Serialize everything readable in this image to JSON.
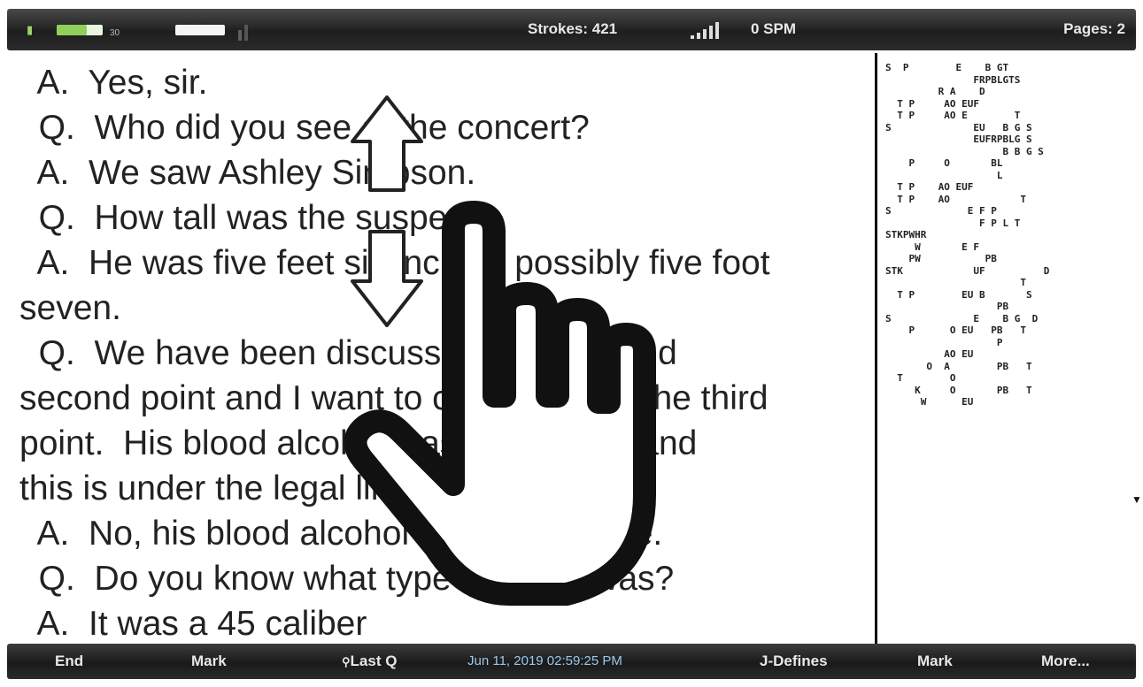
{
  "status": {
    "battery1_label": "30",
    "strokes": "Strokes: 421",
    "spm": "0 SPM",
    "pages": "Pages: 2"
  },
  "transcript": [
    "  A.  Yes, sir.",
    "  Q.  Who did you see at the concert?",
    "  A.  We saw Ashley Simpson.",
    "  Q.  How tall was the suspect?",
    "  A.  He was five feet six inches, possibly five foot",
    "seven.",
    "  Q.  We have been discussing the first and",
    "second point and I want to continue with the third",
    "point.  His blood alcohol was point three and",
    "this is under the legal limit?",
    "  A.  No, his blood alcohol was point three.",
    "  Q.  Do you know what type of gun it was?",
    "  A.  It was a 45 caliber"
  ],
  "steno": [
    "S  P        E    B GT",
    "               FRPBLGTS",
    "         R A    D",
    "  T P     AO EUF",
    "  T P     AO E        T",
    "S              EU   B G S",
    "               EUFRPBLG S",
    "                    B B G S",
    "    P     O       BL",
    "                   L",
    "  T P    AO EUF",
    "  T P    AO            T",
    "S             E F P",
    "                F P L T",
    "STKPWHR",
    "     W       E F",
    "    PW           PB",
    "STK            UF          D",
    "                       T",
    "  T P        EU B       S",
    "                   PB",
    "S              E    B G  D",
    "    P      O EU   PB   T",
    "                   P",
    "          AO EU",
    "       O  A        PB   T",
    "  T        O",
    "     K     O       PB   T",
    "      W      EU"
  ],
  "bottom": {
    "end": "End",
    "mark1": "Mark",
    "last_q": "Last Q",
    "clock": "Jun 11, 2019  02:59:25 PM",
    "j_defines": "J-Defines",
    "mark2": "Mark",
    "more": "More..."
  },
  "icons": {
    "battery": "battery-icon",
    "wifi": "wifi-icon",
    "signal": "signal-bars-icon",
    "search": "search-icon",
    "hand": "hand-pointer-icon",
    "arrows": "up-down-arrows-icon"
  }
}
